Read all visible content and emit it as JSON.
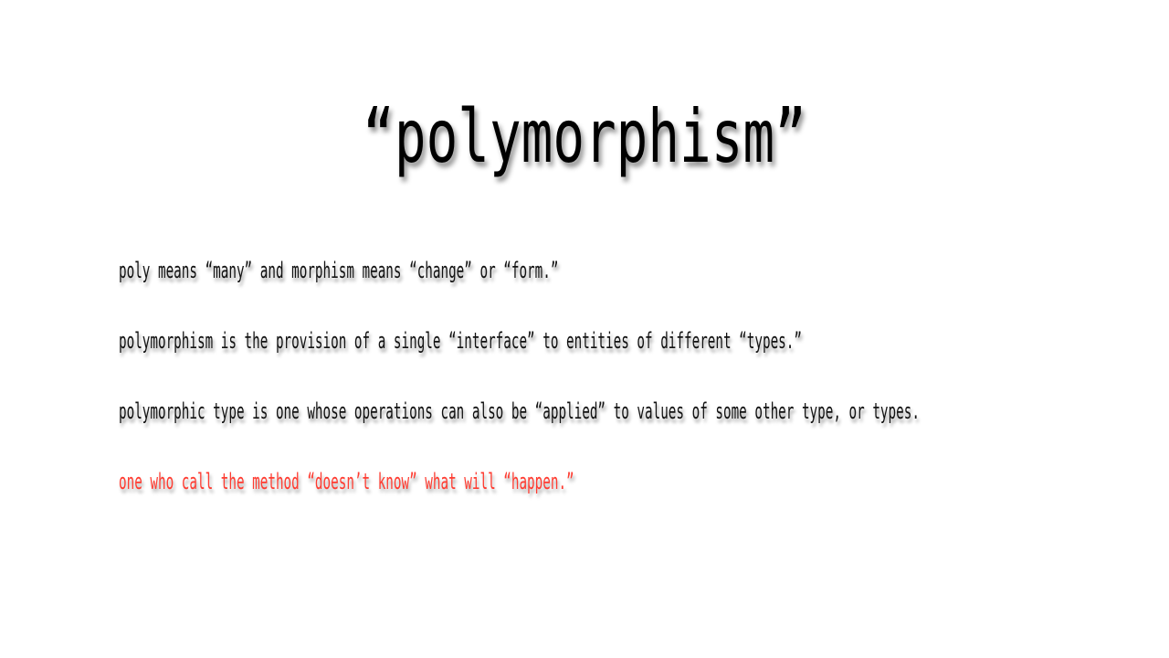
{
  "slide": {
    "title": "“polymorphism”",
    "lines": [
      "poly means “many” and morphism means “change” or “form.”",
      "polymorphism is the provision of a single “interface” to entities of different “types.”",
      "polymorphic type is one whose operations can also be “applied” to values of some other type, or types.",
      "one who call the method “doesn’t know” what will “happen.”"
    ],
    "highlight_color": "#ff3b30"
  }
}
